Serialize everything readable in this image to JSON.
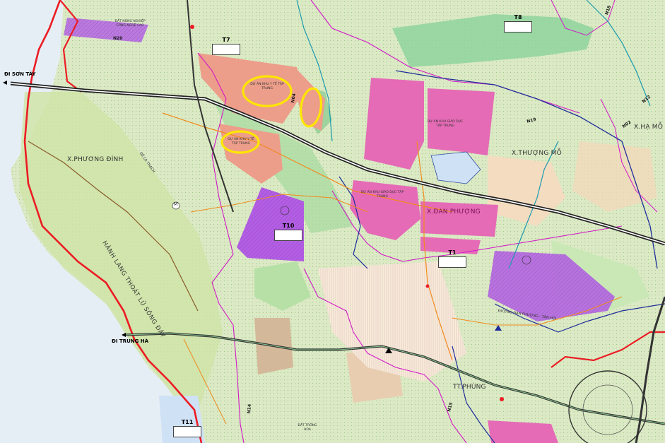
{
  "map": {
    "directions": {
      "son_tay": "ĐI SƠN TÂY",
      "trung_ha": "ĐI TRUNG HÀ"
    },
    "communes": {
      "phuong_dinh": "X.PHƯƠNG ĐÌNH",
      "thuong_mo": "X.THƯỢNG MỖ",
      "dan_phuong": "X.ĐAN PHƯỢNG",
      "tt_phung": "TT.PHÙNG",
      "ha_mo": "X.HẠ MỖ"
    },
    "corridor": "HÀNH LANG THOÁT LŨ SÔNG ĐÁY",
    "projects": {
      "y_te_1": "DỰ ÁN KHU Y TẾ TẬP TRUNG",
      "y_te_2": "DỰ ÁN KHU Y TẾ TẬP TRUNG",
      "giao_duc_1": "DỰ ÁN KHU GIÁO DỤC TẬP TRUNG",
      "giao_duc_2": "DỰ ÁN KHU GIÁO DỤC TẬP TRUNG"
    },
    "misc_labels": {
      "cong_nghe_cao": "ĐẤT NÔNG NGHIỆP CÔNG NGHỆ CAO",
      "de_la_thach": "ĐÊ LA THẠCH",
      "trong_hoa": "ĐẤT TRỒNG HOA",
      "duong_dan_phuong": "ĐƯỜNG ĐAN PHƯỢNG - TÂN HỘI"
    },
    "roads": [
      "N20",
      "N04",
      "N14",
      "N15",
      "N19",
      "N12",
      "N02",
      "N18"
    ],
    "zone_codes": [
      "T7",
      "T8",
      "T10",
      "T1",
      "T11"
    ],
    "marker_m": "M"
  },
  "colors": {
    "water": "#e6eef5",
    "agri": "#d9ecc0",
    "green": "#9ed39e",
    "residential": "#f4e2c4",
    "medical": "#ec9e8a",
    "education": "#e56bb6",
    "special": "#b35ee3",
    "boundary": "#ec1c24",
    "expressway": "#222222",
    "highlight": "#ffe600"
  }
}
